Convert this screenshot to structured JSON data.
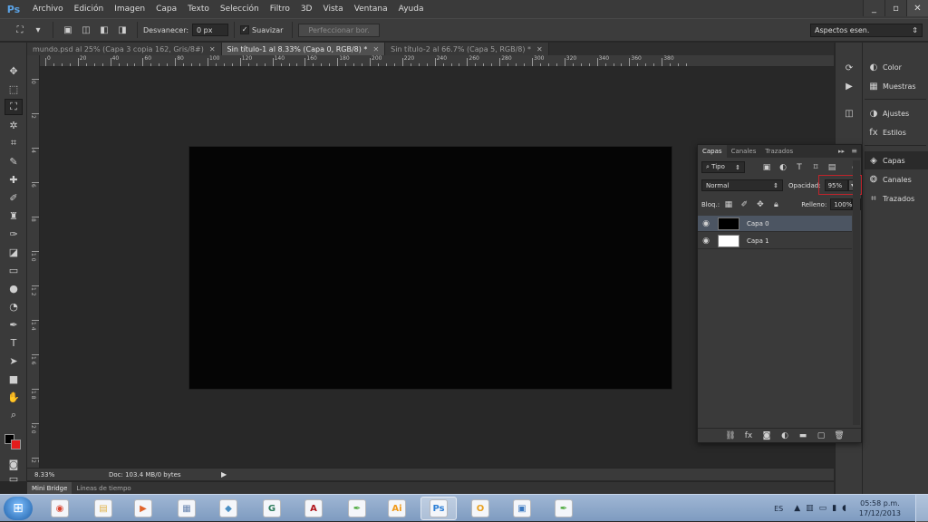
{
  "app": {
    "logo": "Ps"
  },
  "menu": [
    "Archivo",
    "Edición",
    "Imagen",
    "Capa",
    "Texto",
    "Selección",
    "Filtro",
    "3D",
    "Vista",
    "Ventana",
    "Ayuda"
  ],
  "window_controls": {
    "minimize": "_",
    "restore": "▫",
    "close": "✕"
  },
  "options_bar": {
    "feather_label": "Desvanecer:",
    "feather_value": "0 px",
    "smooth_checked": "✓",
    "smooth_label": "Suavizar",
    "refine_label": "Perfeccionar bor.",
    "workspace_value": "Aspectos esen.",
    "workspace_arrow": "⇕"
  },
  "document_tabs": [
    {
      "label": "mundo.psd al 25% (Capa 3 copia 162, Gris/8#)",
      "close": "✕",
      "active": false
    },
    {
      "label": "Sin título-1 al 8.33% (Capa 0, RGB/8) *",
      "close": "✕",
      "active": true
    },
    {
      "label": "Sin título-2 al 66.7% (Capa 5, RGB/8) *",
      "close": "✕",
      "active": false
    }
  ],
  "ruler_h_labels": [
    "0",
    "20",
    "40",
    "60",
    "80",
    "100",
    "120",
    "140",
    "160",
    "180",
    "200",
    "220",
    "240",
    "260",
    "280",
    "300",
    "320",
    "340",
    "360",
    "380"
  ],
  "ruler_v_labels": [
    "0",
    "2",
    "4",
    "6",
    "8",
    "1 0",
    "1 2",
    "1 4",
    "1 6",
    "1 8",
    "2 0",
    "2 2"
  ],
  "status": {
    "zoom": "8.33%",
    "doc_info": "Doc: 103.4 MB/0 bytes",
    "arrow": "▶"
  },
  "bottom_tabs": [
    {
      "label": "Mini Bridge",
      "active": true
    },
    {
      "label": "Líneas de tiempo",
      "active": false
    }
  ],
  "dock": {
    "items": [
      {
        "label": "Color",
        "icon": "◐"
      },
      {
        "label": "Muestras",
        "icon": "▦"
      },
      {
        "label": "Ajustes",
        "icon": "◑"
      },
      {
        "label": "Estilos",
        "icon": "fx"
      },
      {
        "label": "Capas",
        "icon": "◈"
      },
      {
        "label": "Canales",
        "icon": "❂"
      },
      {
        "label": "Trazados",
        "icon": "⌗"
      }
    ]
  },
  "layers_panel": {
    "tabs": [
      "Capas",
      "Canales",
      "Trazados"
    ],
    "menu_icon": "≡",
    "collapse_icon": "▸▸",
    "filter_label": "⌕ Tipo",
    "blend_mode": "Normal",
    "opacity_label": "Opacidad:",
    "opacity_value": "95%",
    "lock_label": "Bloq.:",
    "fill_label": "Relleno:",
    "fill_value": "100%",
    "layers": [
      {
        "name": "Capa 0",
        "selected": true,
        "thumb_color": "#000000"
      },
      {
        "name": "Capa 1",
        "selected": false,
        "thumb_color": "#ffffff"
      }
    ]
  },
  "taskbar": {
    "lang": "ES",
    "time": "05:58 p.m.",
    "date": "17/12/2013",
    "apps": [
      {
        "name": "chrome",
        "glyph": "◉",
        "color": "#d9432f"
      },
      {
        "name": "explorer",
        "glyph": "▤",
        "color": "#e0b34a"
      },
      {
        "name": "media",
        "glyph": "▶",
        "color": "#e0632a"
      },
      {
        "name": "calculator",
        "glyph": "▦",
        "color": "#6a86b0"
      },
      {
        "name": "paint",
        "glyph": "◆",
        "color": "#4a8fc4"
      },
      {
        "name": "g-app",
        "glyph": "G",
        "color": "#2a7a5a"
      },
      {
        "name": "acrobat",
        "glyph": "A",
        "color": "#b0141c"
      },
      {
        "name": "corel",
        "glyph": "✒",
        "color": "#4aa83a"
      },
      {
        "name": "illustrator",
        "glyph": "Ai",
        "color": "#f09a1a"
      },
      {
        "name": "photoshop",
        "glyph": "Ps",
        "color": "#2d7fd6"
      },
      {
        "name": "outlook",
        "glyph": "O",
        "color": "#e8a020"
      },
      {
        "name": "photo-viewer",
        "glyph": "▣",
        "color": "#3a78c0"
      },
      {
        "name": "corel-2",
        "glyph": "✒",
        "color": "#4aa83a"
      }
    ]
  }
}
